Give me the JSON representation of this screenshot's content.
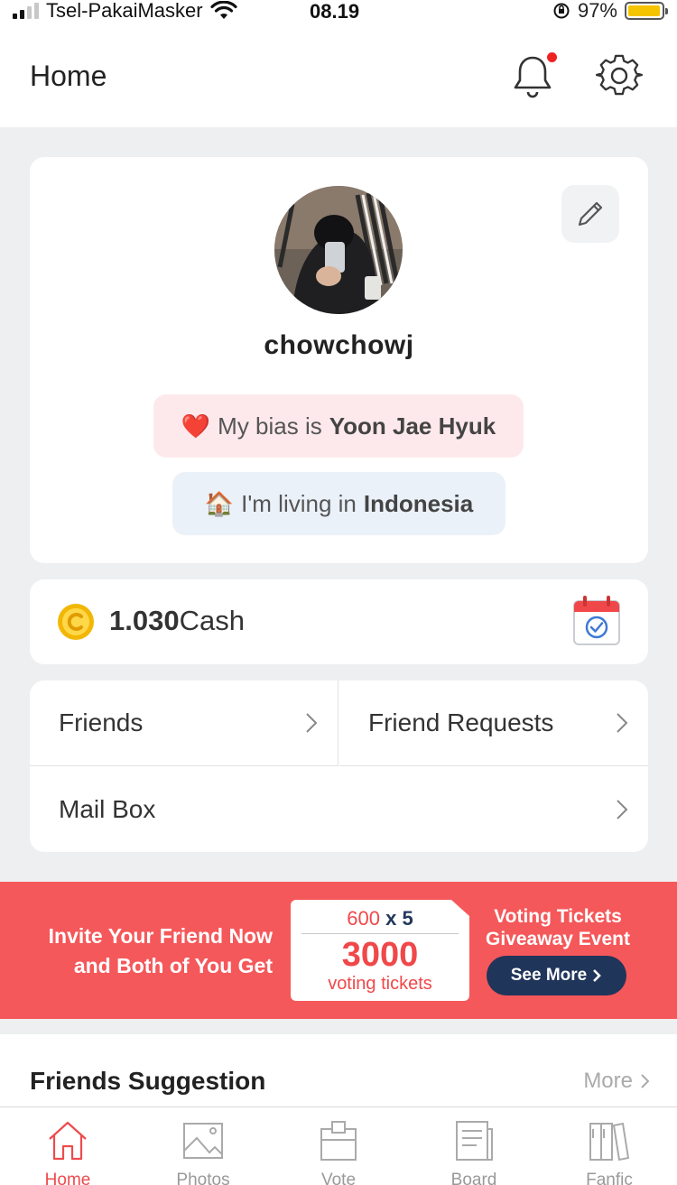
{
  "status_bar": {
    "carrier": "Tsel-PakaiMasker",
    "time": "08.19",
    "battery": "97%",
    "battery_level": 0.97
  },
  "header": {
    "title": "Home",
    "notification_icon": "bell-icon",
    "settings_icon": "gear-icon",
    "has_notification": true
  },
  "profile": {
    "username": "chowchowj",
    "bias_emoji": "❤️",
    "bias_prefix": "My bias is",
    "bias_name": "Yoon Jae Hyuk",
    "living_emoji": "🏠",
    "living_prefix": "I'm living in",
    "living_country": "Indonesia",
    "edit_icon": "pencil-icon"
  },
  "cash": {
    "amount": "1.030",
    "unit": "Cash",
    "coin_icon": "coin-icon",
    "calendar_icon": "calendar-check-icon"
  },
  "menu": {
    "friends": "Friends",
    "friend_requests": "Friend Requests",
    "mail_box": "Mail Box"
  },
  "banner": {
    "left_line1": "Invite Your Friend Now",
    "left_line2": "and Both of You Get",
    "ticket_amount": "600",
    "ticket_multiplier": "x 5",
    "ticket_total": "3000",
    "ticket_unit": "voting tickets",
    "right_line1": "Voting Tickets",
    "right_line2": "Giveaway Event",
    "button_label": "See More",
    "colors": {
      "background": "#f5585a",
      "button": "#20355a"
    }
  },
  "suggestion": {
    "title": "Friends Suggestion",
    "more_label": "More"
  },
  "bottom_nav": [
    {
      "label": "Home",
      "icon": "home-icon",
      "active": true
    },
    {
      "label": "Photos",
      "icon": "photos-icon",
      "active": false
    },
    {
      "label": "Vote",
      "icon": "vote-box-icon",
      "active": false
    },
    {
      "label": "Board",
      "icon": "board-icon",
      "active": false
    },
    {
      "label": "Fanfic",
      "icon": "books-icon",
      "active": false
    }
  ],
  "colors": {
    "accent": "#ee4b4e",
    "page_bg": "#eeeff1"
  }
}
